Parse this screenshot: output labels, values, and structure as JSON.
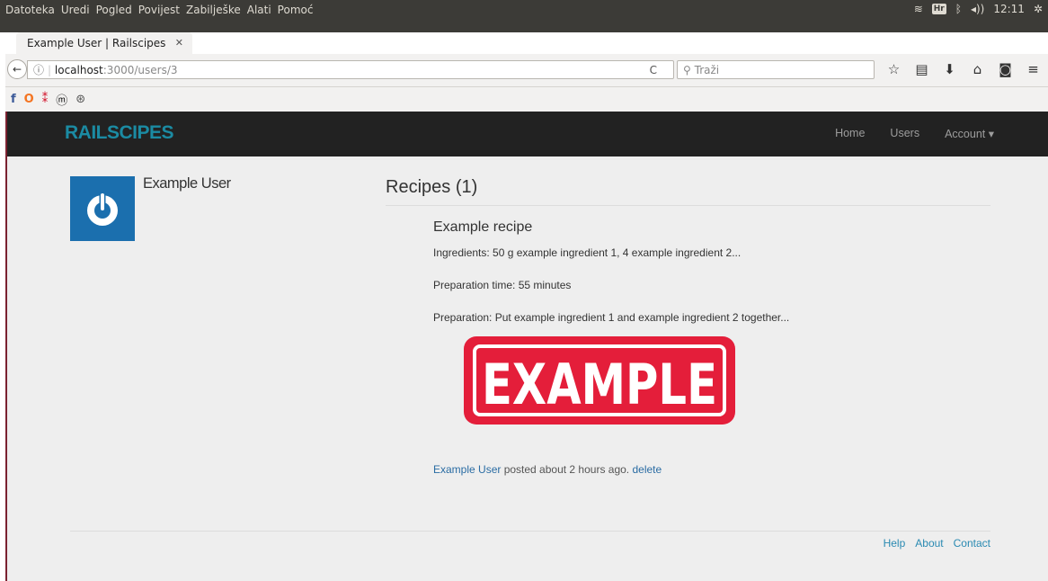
{
  "os": {
    "menu": [
      "Datoteka",
      "Uredi",
      "Pogled",
      "Povijest",
      "Zabilješke",
      "Alati",
      "Pomoć"
    ],
    "keyboard_layout": "Hr",
    "clock": "12:11"
  },
  "browser": {
    "tab_title": "Example User | Railscipes",
    "url_host": "localhost",
    "url_path": ":3000/users/3",
    "search_placeholder": "Traži"
  },
  "site": {
    "logo": "RAILSCIPES",
    "nav": {
      "home": "Home",
      "users": "Users",
      "account": "Account ▾"
    },
    "brand_color": "#1b8ba3"
  },
  "profile": {
    "name": "Example User"
  },
  "recipes": {
    "heading": "Recipes (1)",
    "items": [
      {
        "title": "Example recipe",
        "ingredients": "Ingredients: 50 g example ingredient 1, 4 example ingredient 2...",
        "prep_time": "Preparation time: 55 minutes",
        "preparation": "Preparation: Put example ingredient 1 and example ingredient 2 together...",
        "image_text": "EXAMPLE",
        "author": "Example User",
        "posted": " posted about 2 hours ago. ",
        "delete": "delete"
      }
    ]
  },
  "footer": {
    "help": "Help",
    "about": "About",
    "contact": "Contact"
  }
}
